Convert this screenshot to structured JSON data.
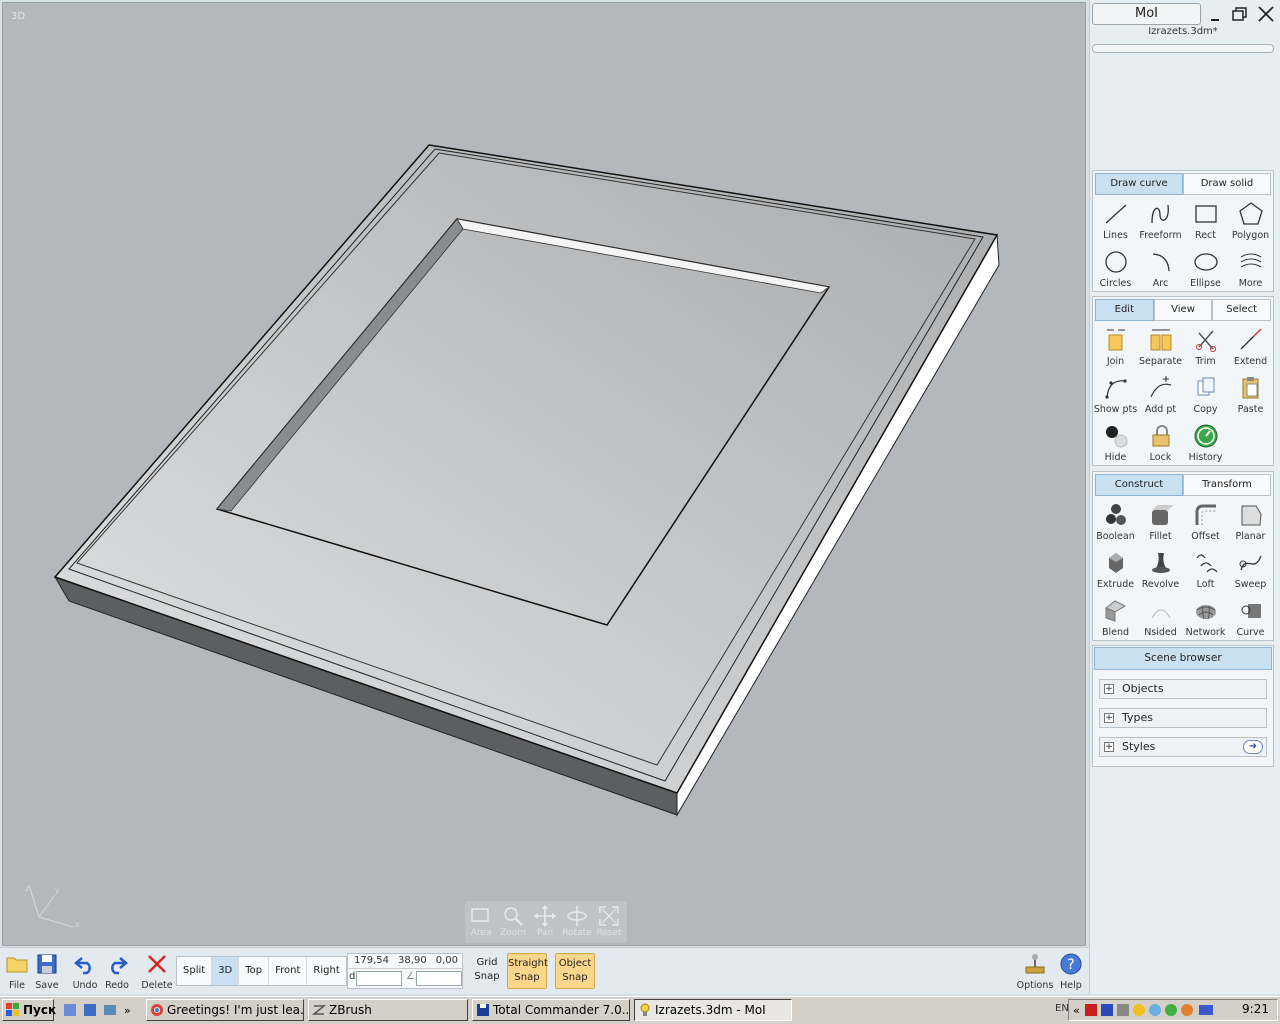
{
  "viewport": {
    "label": "3D",
    "axes": {
      "x": "x",
      "y": "y",
      "z": "z"
    },
    "nav": [
      {
        "name": "area",
        "label": "Area",
        "icon": "area-zoom-icon"
      },
      {
        "name": "zoom",
        "label": "Zoom",
        "icon": "magnifier-icon"
      },
      {
        "name": "pan",
        "label": "Pan",
        "icon": "pan-arrows-icon"
      },
      {
        "name": "rotate",
        "label": "Rotate",
        "icon": "rotate-icon"
      },
      {
        "name": "reset",
        "label": "Reset",
        "icon": "reset-view-icon"
      }
    ]
  },
  "panel": {
    "app_title": "MoI",
    "filename": "Izrazets.3dm*",
    "draw": {
      "tabs": [
        "Draw curve",
        "Draw solid"
      ],
      "tools": [
        "Lines",
        "Freeform",
        "Rect",
        "Polygon",
        "Circles",
        "Arc",
        "Ellipse",
        "More"
      ]
    },
    "edit": {
      "tabs": [
        "Edit",
        "View",
        "Select"
      ],
      "tools": [
        "Join",
        "Separate",
        "Trim",
        "Extend",
        "Show pts",
        "Add pt",
        "Copy",
        "Paste",
        "Hide",
        "Lock",
        "History"
      ]
    },
    "construct": {
      "tabs": [
        "Construct",
        "Transform"
      ],
      "tools": [
        "Boolean",
        "Fillet",
        "Offset",
        "Planar",
        "Extrude",
        "Revolve",
        "Loft",
        "Sweep",
        "Blend",
        "Nsided",
        "Network",
        "Curve"
      ]
    },
    "scene": {
      "title": "Scene browser",
      "items": [
        "Objects",
        "Types",
        "Styles"
      ]
    }
  },
  "bottombar": {
    "file": "File",
    "save": "Save",
    "undo": "Undo",
    "redo": "Redo",
    "delete": "Delete",
    "views": [
      "Split",
      "3D",
      "Top",
      "Front",
      "Right"
    ],
    "active_view": "3D",
    "coords": {
      "x": "179,54",
      "y": "38,90",
      "z": "0,00",
      "d_label": "d",
      "angle_label": "∠"
    },
    "grid_snap": [
      "Grid",
      "Snap"
    ],
    "straight_snap": [
      "Straight",
      "Snap"
    ],
    "object_snap": [
      "Object",
      "Snap"
    ],
    "options": "Options",
    "help": "Help"
  },
  "taskbar": {
    "start": "Пуск",
    "tasks": [
      {
        "label": "Greetings! I'm just lea...",
        "icon": "chrome-icon"
      },
      {
        "label": "ZBrush",
        "icon": "zbrush-icon"
      },
      {
        "label": "Total Commander 7.0...",
        "icon": "floppy-icon"
      },
      {
        "label": "Izrazets.3dm - MoI",
        "icon": "bulb-icon"
      }
    ],
    "lang": "EN",
    "clock": "9:21"
  }
}
